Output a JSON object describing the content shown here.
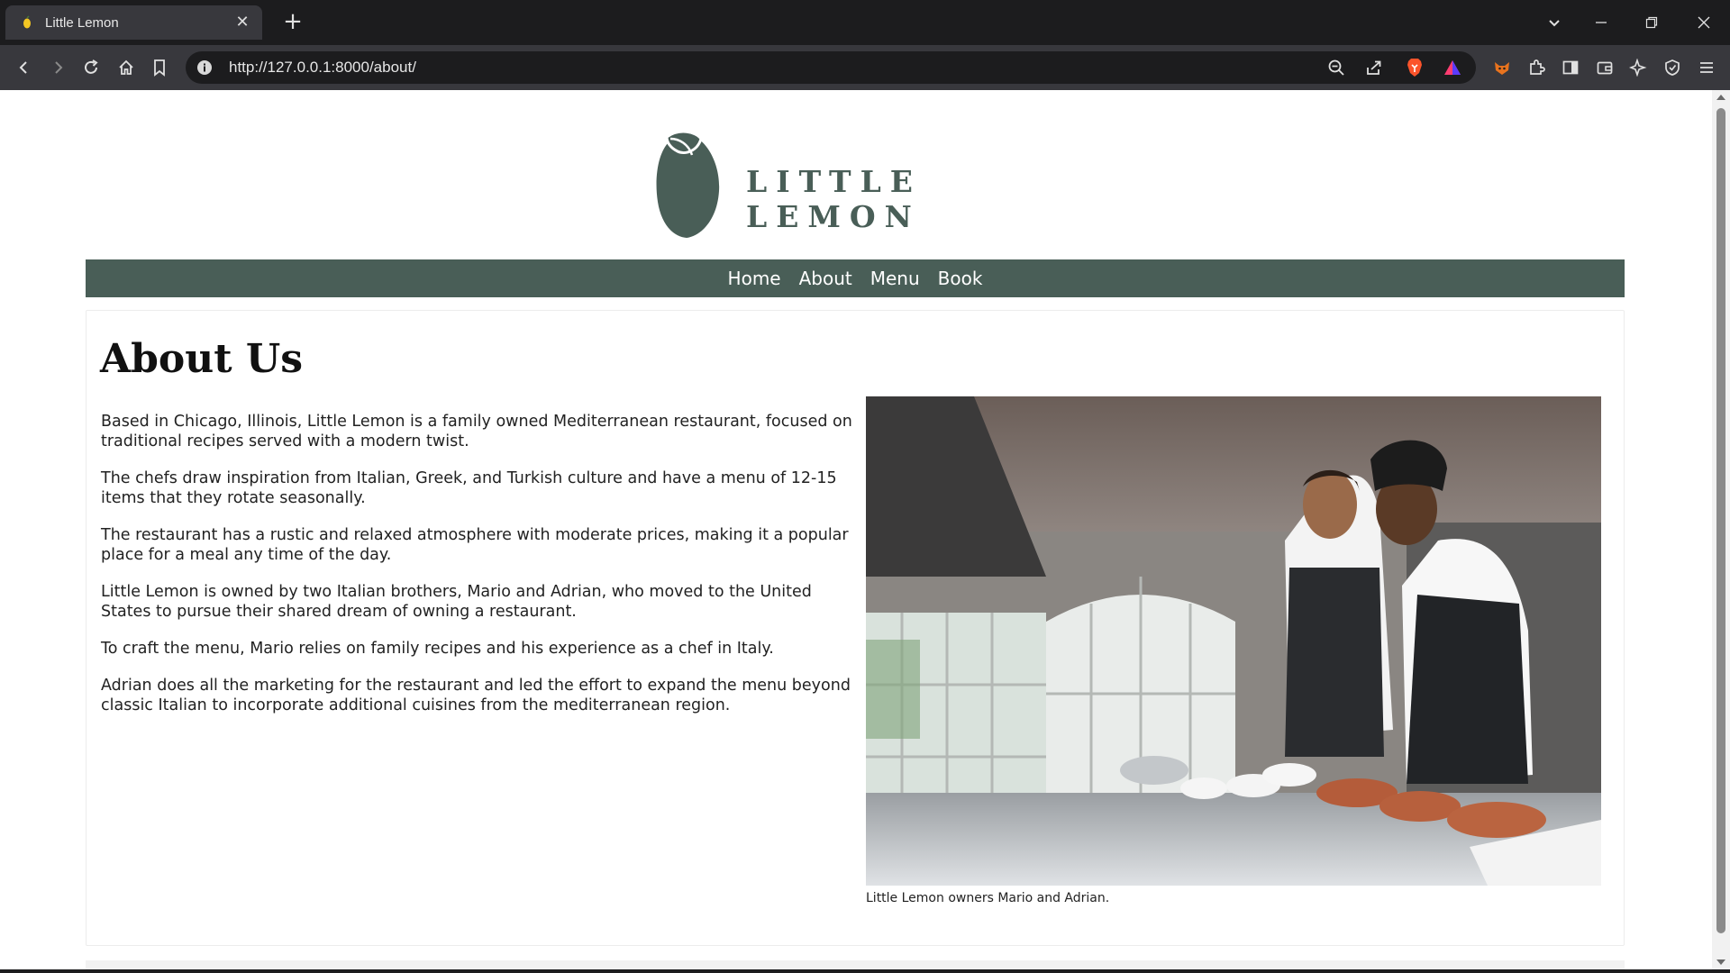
{
  "browser": {
    "tab_title": "Little Lemon",
    "url": "http://127.0.0.1:8000/about/"
  },
  "site": {
    "logo_text": "LITTLE LEMON",
    "brand_color": "#495e57",
    "nav": [
      {
        "label": "Home"
      },
      {
        "label": "About"
      },
      {
        "label": "Menu"
      },
      {
        "label": "Book"
      }
    ]
  },
  "about": {
    "title": "About Us",
    "paragraphs": [
      "Based in Chicago, Illinois, Little Lemon is a family owned Mediterranean restaurant, focused on traditional recipes served with a modern twist.",
      "The chefs draw inspiration from Italian, Greek, and Turkish culture and have a menu of 12-15 items that they rotate seasonally.",
      "The restaurant has a rustic and relaxed atmosphere with moderate prices, making it a popular place for a meal any time of the day.",
      "Little Lemon is owned by two Italian brothers, Mario and Adrian, who moved to the United States to pursue their shared dream of owning a restaurant.",
      "To craft the menu, Mario relies on family recipes and his experience as a chef in Italy.",
      "Adrian does all the marketing for the restaurant and led the effort to expand the menu beyond classic Italian to incorporate additional cuisines from the mediterranean region."
    ],
    "image_caption": "Little Lemon owners Mario and Adrian."
  }
}
